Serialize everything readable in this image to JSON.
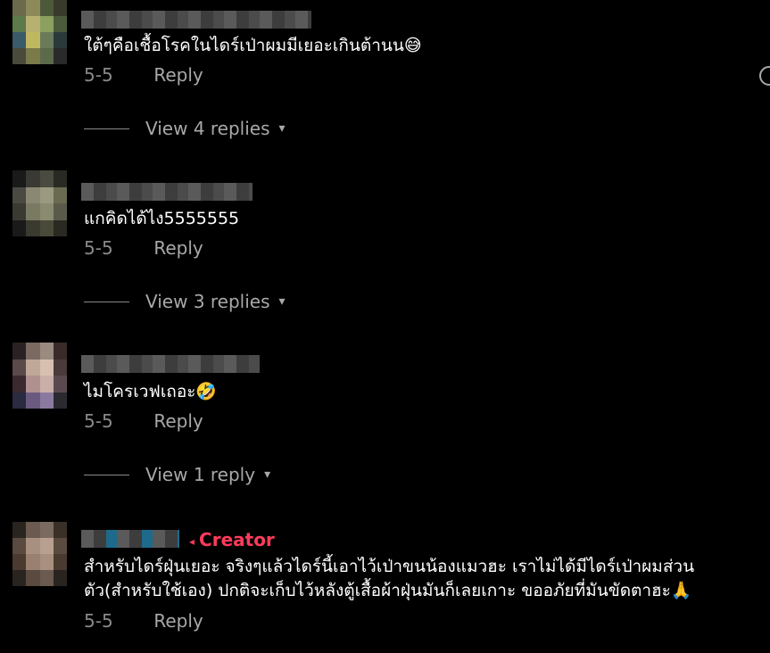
{
  "comments": [
    {
      "text": "ใต้ๆคือเชื้อโรคในไดร์เป่าผมมีเยอะเกินต้านน😅",
      "date": "5-5",
      "reply_label": "Reply",
      "view_replies_label": "View 4 replies"
    },
    {
      "text": "แกคิดได้ไง5555555",
      "date": "5-5",
      "reply_label": "Reply",
      "view_replies_label": "View 3 replies"
    },
    {
      "text": "ไมโครเวฟเถอะ🤣",
      "date": "5-5",
      "reply_label": "Reply",
      "view_replies_label": "View 1 reply"
    },
    {
      "creator_label": "Creator",
      "text": "สำหรับไดร์ฝุ่นเยอะ จริงๆแล้วไดร์นี้เอาไว้เป่าขนน้องแมวฮะ เราไม่ได้มีไดร์เป่าผมส่วนตัว(สำหรับใช้เอง) ปกติจะเก็บไว้หลังตู้เสื้อผ้าฝุ่นมันก็เลยเกาะ ขออภัยที่มันขัดตาฮะ🙏",
      "date": "5-5",
      "reply_label": "Reply"
    }
  ],
  "colors": {
    "background": "#000000",
    "text": "#ffffff",
    "muted": "#8a8a8a",
    "creator": "#ff3b5c"
  },
  "icons": [
    "chevron-down-icon",
    "heart-icon"
  ]
}
